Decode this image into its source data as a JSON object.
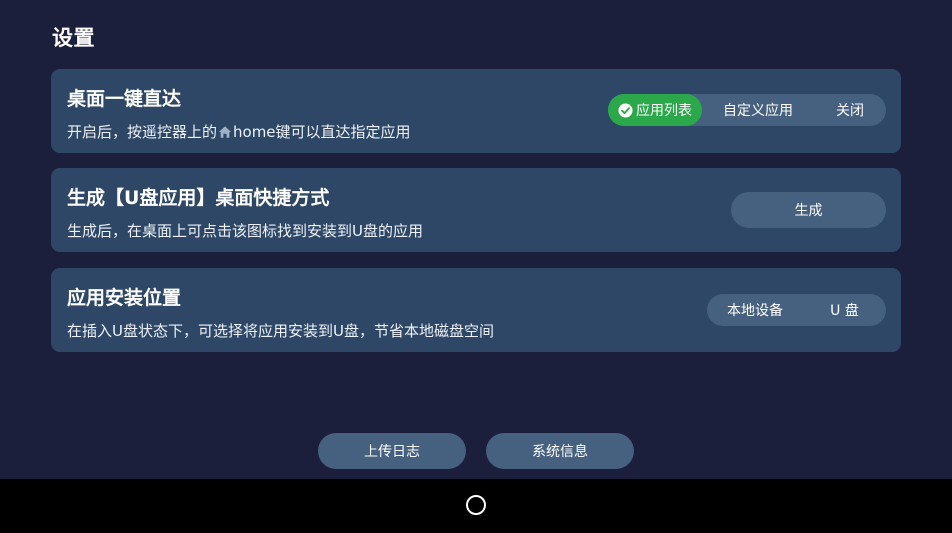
{
  "page": {
    "title": "设置"
  },
  "cards": {
    "desktop_shortcut": {
      "title": "桌面一键直达",
      "desc_prefix": "开启后，按遥控器上的",
      "desc_suffix": "home键可以直达指定应用",
      "icon": "home-icon",
      "options": [
        "应用列表",
        "自定义应用",
        "关闭"
      ],
      "selected": "应用列表",
      "selected_color": "#2aa84a"
    },
    "usb_shortcut": {
      "title": "生成【U盘应用】桌面快捷方式",
      "desc": "生成后，在桌面上可点击该图标找到安装到U盘的应用",
      "button_label": "生成"
    },
    "install_location": {
      "title": "应用安装位置",
      "desc": "在插入U盘状态下，可选择将应用安装到U盘，节省本地磁盘空间",
      "options": [
        "本地设备",
        "U 盘"
      ]
    }
  },
  "footer": {
    "upload_log_label": "上传日志",
    "system_info_label": "系统信息"
  },
  "nav": {
    "home_icon": "circle-home-icon"
  },
  "colors": {
    "background": "#1c1f3b",
    "card": "#2e4766",
    "control": "#46607f",
    "accent": "#2aa84a"
  }
}
